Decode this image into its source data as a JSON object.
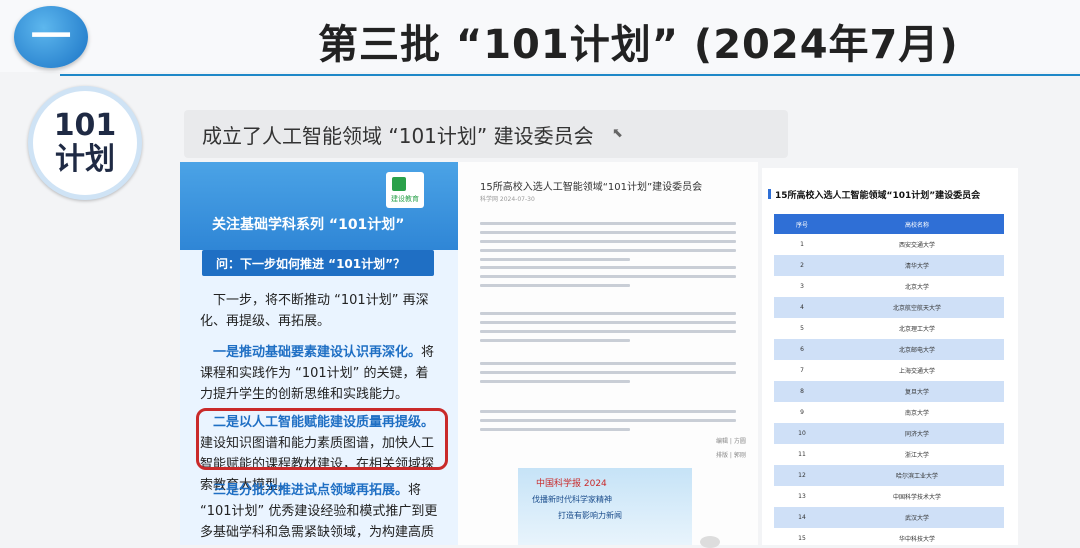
{
  "slide": {
    "badge_round": "一",
    "badge_101_line1": "101",
    "badge_101_line2": "计划",
    "title": "第三批 “101计划” (2024年7月)",
    "subtitle": "成立了人工智能领域 “101计划” 建设委员会"
  },
  "panel1": {
    "logo_text": "建设教育",
    "series_title": "关注基础学科系列 “101计划”",
    "question": "问：下一步如何推进 “101计划”？",
    "para1": "下一步，将不断推动 “101计划” 再深化、再提级、再拓展。",
    "para2_bold": "一是推动基础要素建设认识再深化。",
    "para2_rest": "将课程和实践作为 “101计划” 的关键，着力提升学生的创新思维和实践能力。",
    "para3_bold": "二是以人工智能赋能建设质量再提级。",
    "para3_rest": "建设知识图谱和能力素质图谱，加快人工智能赋能的课程教材建设，在相关领域探索教育大模型。",
    "para4_bold": "三是分批次推进试点领域再拓展。",
    "para4_rest": "将 “101计划” 优秀建设经验和模式推广到更多基础学科和急需紧缺领域，为构建高质量人才培养体系提供全面支撑。"
  },
  "panel2": {
    "article_title": "15所高校入选人工智能领域“101计划”建设委员会",
    "meta": "科学网 2024-07-30",
    "sig1": "编辑 | 方圆",
    "sig2": "排版 | 郭刚",
    "image_line1": "中国科学报 2024",
    "image_line2": "伐播新时代科学家精神",
    "image_line3": "打造有影响力新闻"
  },
  "panel3": {
    "table_title": "15所高校入选人工智能领域“101计划”建设委员会",
    "columns": [
      "序号",
      "高校名称"
    ],
    "rows": [
      [
        "1",
        "西安交通大学"
      ],
      [
        "2",
        "清华大学"
      ],
      [
        "3",
        "北京大学"
      ],
      [
        "4",
        "北京航空航天大学"
      ],
      [
        "5",
        "北京理工大学"
      ],
      [
        "6",
        "北京邮电大学"
      ],
      [
        "7",
        "上海交通大学"
      ],
      [
        "8",
        "复旦大学"
      ],
      [
        "9",
        "南京大学"
      ],
      [
        "10",
        "同济大学"
      ],
      [
        "11",
        "浙江大学"
      ],
      [
        "12",
        "哈尔滨工业大学"
      ],
      [
        "13",
        "中国科学技术大学"
      ],
      [
        "14",
        "武汉大学"
      ],
      [
        "15",
        "华中科技大学"
      ]
    ]
  },
  "colors": {
    "accent_blue": "#2f6fd6",
    "highlight_red": "#c92a2a",
    "title_line": "#1e88c8"
  }
}
